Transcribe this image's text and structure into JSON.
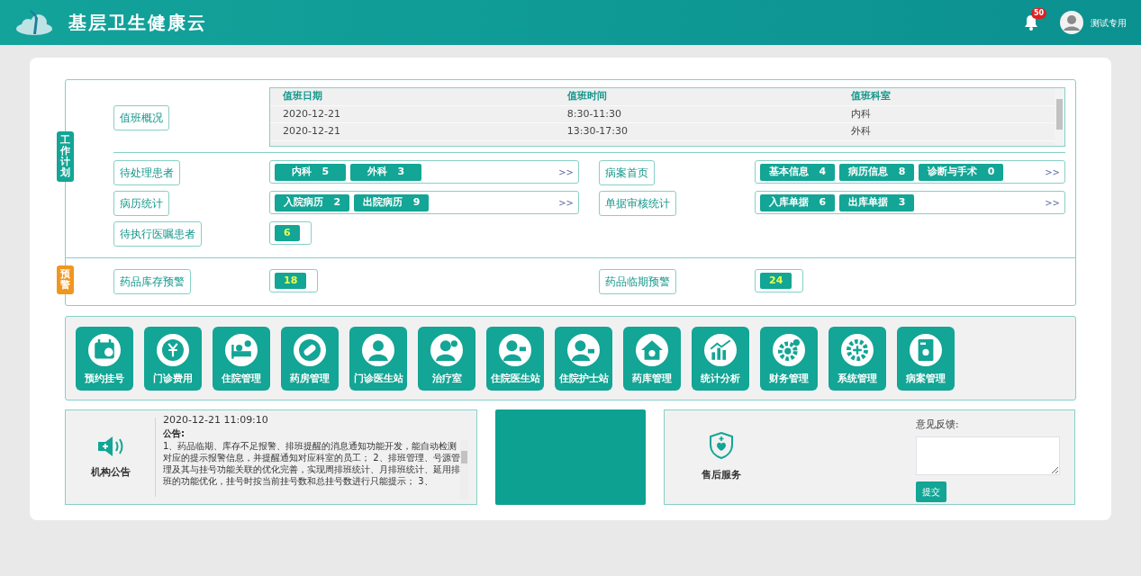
{
  "header": {
    "title": "基层卫生健康云",
    "notification_count": "50",
    "user_name": "测试专用"
  },
  "work_plan": {
    "label": "工作计划",
    "schedule": {
      "label": "值班概况",
      "columns": [
        "值班日期",
        "值班时间",
        "值班科室"
      ],
      "rows": [
        [
          "2020-12-21",
          "8:30-11:30",
          "内科"
        ],
        [
          "2020-12-21",
          "13:30-17:30",
          "外科"
        ]
      ]
    },
    "tasks": [
      {
        "kind": "tags",
        "label": "待处理患者",
        "tags": [
          {
            "name": "内科",
            "count": "5"
          },
          {
            "name": "外科",
            "count": "3"
          }
        ],
        "more": ">>"
      },
      {
        "kind": "tags",
        "label": "病案首页",
        "tags": [
          {
            "name": "基本信息",
            "count": "4"
          },
          {
            "name": "病历信息",
            "count": "8"
          },
          {
            "name": "诊断与手术",
            "count": "0"
          }
        ],
        "more": ">>"
      },
      {
        "kind": "tags",
        "label": "病历统计",
        "tags": [
          {
            "name": "入院病历",
            "count": "2"
          },
          {
            "name": "出院病历",
            "count": "9"
          }
        ],
        "more": ">>"
      },
      {
        "kind": "tags",
        "label": "单据审核统计",
        "tags": [
          {
            "name": "入库单据",
            "count": "6"
          },
          {
            "name": "出库单据",
            "count": "3"
          }
        ],
        "more": ">>"
      },
      {
        "kind": "count",
        "label": "待执行医嘱患者",
        "count": "6"
      }
    ]
  },
  "warnings": {
    "label": "预警",
    "items": [
      {
        "kind": "count",
        "label": "药品库存预警",
        "count": "18"
      },
      {
        "kind": "count",
        "label": "药品临期预警",
        "count": "24"
      }
    ]
  },
  "modules": [
    {
      "label": "预约挂号"
    },
    {
      "label": "门诊费用"
    },
    {
      "label": "住院管理"
    },
    {
      "label": "药房管理"
    },
    {
      "label": "门诊医生站"
    },
    {
      "label": "治疗室"
    },
    {
      "label": "住院医生站"
    },
    {
      "label": "住院护士站"
    },
    {
      "label": "药库管理"
    },
    {
      "label": "统计分析"
    },
    {
      "label": "财务管理"
    },
    {
      "label": "系统管理"
    },
    {
      "label": "病案管理"
    }
  ],
  "notice": {
    "label": "机构公告",
    "datetime": "2020-12-21 11:09:10",
    "heading": "公告:",
    "body": "1、药品临期、库存不足报警、排班提醒的消息通知功能开发，能自动检测对应的提示报警信息，并提醒通知对应科室的员工； 2、排班管理、号源管理及其与挂号功能关联的优化完善，实现周排班统计、月排班统计、延用排班的功能优化，挂号时按当前挂号数和总挂号数进行只能提示； 3、"
  },
  "service": {
    "label": "售后服务",
    "feedback_label": "意见反馈:",
    "submit": "提交"
  }
}
